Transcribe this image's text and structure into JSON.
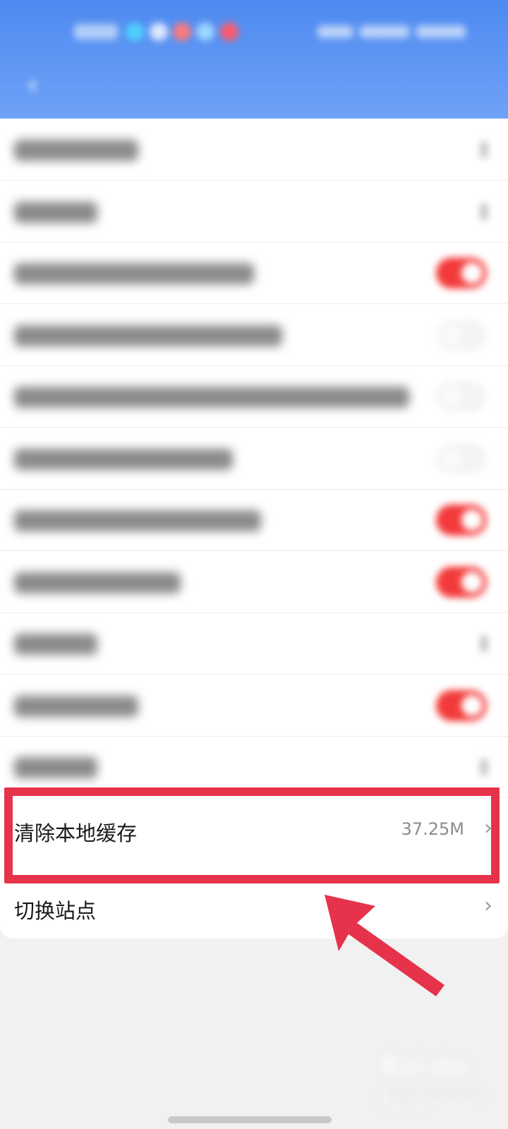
{
  "colors": {
    "header_gradient_top": "#4d8af0",
    "header_gradient_bottom": "#6fa2f7",
    "toggle_on": "#f33a3a",
    "toggle_off": "#f4f4f4",
    "highlight": "#e6334b",
    "page_bg": "#f1f1f1"
  },
  "header": {
    "back_icon": "chevron-left-icon"
  },
  "settings_rows": [
    {
      "control": "chevron"
    },
    {
      "control": "chevron"
    },
    {
      "control": "toggle",
      "on": true
    },
    {
      "control": "toggle",
      "on": false
    },
    {
      "control": "toggle",
      "on": false
    },
    {
      "control": "toggle",
      "on": false
    },
    {
      "control": "toggle",
      "on": true
    },
    {
      "control": "toggle",
      "on": true
    },
    {
      "control": "chevron"
    },
    {
      "control": "toggle",
      "on": true
    },
    {
      "control": "chevron"
    }
  ],
  "cache": {
    "label": "清除本地缓存",
    "size": "37.25M",
    "chevron": "›"
  },
  "switch_site": {
    "label": "切换站点",
    "chevron": "›"
  },
  "annotation": {
    "highlight_color": "#e6334b",
    "arrow_color": "#e6334b"
  },
  "watermark": {
    "text": "Bai du 经验",
    "sub": "jingyan.baidu.com"
  }
}
